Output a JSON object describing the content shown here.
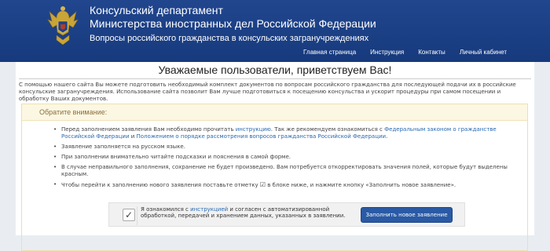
{
  "header": {
    "title_line1": "Консульский департамент",
    "title_line2": "Министерства иностранных дел Российской Федерации",
    "subtitle": "Вопросы российского гражданства в консульских загранучреждениях",
    "emblem_icon": "double-headed-eagle-emblem",
    "background_color": "#1e4287"
  },
  "nav": {
    "items": [
      "Главная страница",
      "Инструкция",
      "Контакты",
      "Личный кабинет"
    ]
  },
  "main": {
    "welcome": "Уважаемые пользователи, приветствуем Вас!",
    "intro": "С помощью нашего сайта Вы можете подготовить необходимый комплект документов по вопросам российского гражданства для последующей подачи их в российские консульские загранучреждения. Использование сайта позволит Вам лучше подготовиться к посещению консульства и ускорит процедуры при самом посещении и обработку Ваших документов."
  },
  "attention": {
    "title": "Обратите внимание:",
    "item1_a": "Перед заполнением заявления Вам необходимо прочитать ",
    "item1_link1": "инструкцию",
    "item1_b": ". Так же рекомендуем ознакомиться с ",
    "item1_link2": "Федеральным законом о гражданстве Российской Федерации",
    "item1_c": " и ",
    "item1_link3": "Положением о порядке рассмотрения вопросов гражданства Российской Федерации",
    "item1_d": ".",
    "item2": "Заявление заполняется на русском языке.",
    "item3": "При заполнении внимательно читайте подсказки и пояснения в самой форме.",
    "item4": "В случае неправильного заполнения, сохранение не будет произведено. Вам потребуется откорректировать значения полей, которые будут выделены красным.",
    "item5_a": "Чтобы перейти к заполнению нового заявления поставьте отметку ",
    "item5_b": " в блоке ниже, и нажмите кнопку «Заполнить новое заявление».",
    "check_glyph": "☑"
  },
  "agree": {
    "checked_mark": "✓",
    "text_a": "Я ознакомился с ",
    "text_link": "инструкцией",
    "text_b": " и согласен с автоматизированной обработкой, передачей и хранением данных, указанных в заявлении.",
    "button_label": "Заполнить новое заявление"
  }
}
